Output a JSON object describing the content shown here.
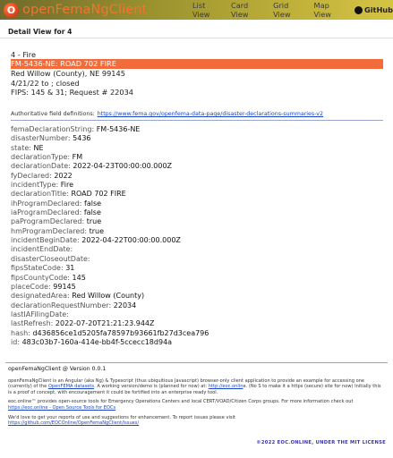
{
  "app": {
    "title": "openFemaNgClient",
    "logo_glyph": "O"
  },
  "nav": {
    "items": [
      "List View",
      "Card View",
      "Grid View",
      "Map View"
    ],
    "github_label": "GitHub"
  },
  "page": {
    "heading": "Detail View for 4"
  },
  "summary": {
    "line1": "4 - Fire",
    "highlight": "FM-5436-NE:   ROAD 702 FIRE",
    "line3": "Red Willow (County), NE 99145",
    "line4": "4/21/22 to ; closed",
    "line5": "FIPS: 145 & 31; Request # 22034"
  },
  "auth": {
    "label": "Authoritative field definitions:",
    "link": "https://www.fema.gov/openfema-data-page/disaster-declarations-summaries-v2"
  },
  "fields": [
    {
      "k": "femaDeclarationString",
      "v": "FM-5436-NE"
    },
    {
      "k": "disasterNumber",
      "v": "5436"
    },
    {
      "k": "state",
      "v": "NE"
    },
    {
      "k": "declarationType",
      "v": "FM"
    },
    {
      "k": "declarationDate",
      "v": "2022-04-23T00:00:00.000Z"
    },
    {
      "k": "fyDeclared",
      "v": "2022"
    },
    {
      "k": "incidentType",
      "v": "Fire"
    },
    {
      "k": "declarationTitle",
      "v": "ROAD 702 FIRE"
    },
    {
      "k": "ihProgramDeclared",
      "v": "false"
    },
    {
      "k": "iaProgramDeclared",
      "v": "false"
    },
    {
      "k": "paProgramDeclared",
      "v": "true"
    },
    {
      "k": "hmProgramDeclared",
      "v": "true"
    },
    {
      "k": "incidentBeginDate",
      "v": "2022-04-22T00:00:00.000Z"
    },
    {
      "k": "incidentEndDate",
      "v": ""
    },
    {
      "k": "disasterCloseoutDate",
      "v": ""
    },
    {
      "k": "fipsStateCode",
      "v": "31"
    },
    {
      "k": "fipsCountyCode",
      "v": "145"
    },
    {
      "k": "placeCode",
      "v": "99145"
    },
    {
      "k": "designatedArea",
      "v": "Red Willow (County)"
    },
    {
      "k": "declarationRequestNumber",
      "v": "22034"
    },
    {
      "k": "lastIAFilingDate",
      "v": ""
    },
    {
      "k": "lastRefresh",
      "v": "2022-07-20T21:21:23.944Z"
    },
    {
      "k": "hash",
      "v": "d436856ce1d5205fa78597b93661fb27d3cea796"
    },
    {
      "k": "id",
      "v": "483c03b7-160a-414e-bb4f-5ccecc18d94a"
    }
  ],
  "footer": {
    "title": "openFemaNgClient @ Version 0.0.1",
    "p1_pre": "openFemaNgClient is an Angular (aka Ng) & Typescript (thus ubiquitious Javascript) browser-only client application to provide an example for accessing one (currently) of the ",
    "p1_link1": "OpenFEMA datasets",
    "p1_mid": ". A working version/demo is (planned for now) at: ",
    "p1_link2": "http://eoc.onlin",
    "p1_post": "e. (No S to make it a https (secure) site for now) Initially this is a proof of concept, with encouragement it could be fortified into an enterprise ready tool.",
    "p2_pre": "eoc.online™ provides open-source tools for Emergency Operations Centers and local CERT/VOAD/Citizen Corps groups. For more information check out ",
    "p2_link": "https://eoc.online - Open Source Tools for EOCs",
    "p3_pre": "We'd love to get your reports of use and suggestions for enhancement. To report issues please visit ",
    "p3_link": "https://github.com/EOCOnline/OpenFemaNgClient/issues/",
    "copyright": "©2022 EOC.ONLINE, UNDER THE MIT LICENSE"
  }
}
